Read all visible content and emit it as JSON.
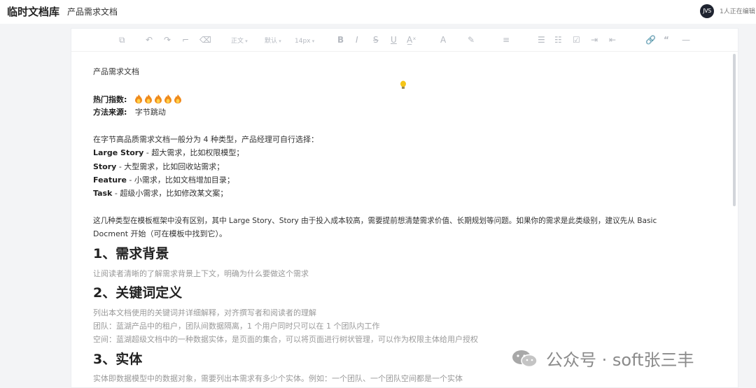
{
  "app": {
    "title": "临时文档库",
    "doc_title": "产品需求文档",
    "avatar_text": "JVS",
    "editing_status": "1人正在编辑"
  },
  "toolbar": {
    "paragraph": "正文",
    "font": "默认",
    "size": "14px"
  },
  "doc": {
    "title": "产品需求文档",
    "hot_label": "热门指数:",
    "hot_count": 5,
    "source_label": "方法来源:",
    "source_value": "字节跳动",
    "intro": "在字节高品质需求文档一般分为 4 种类型，产品经理可自行选择：",
    "types": [
      {
        "name": "Large Story",
        "desc": " - 超大需求，比如权限模型；"
      },
      {
        "name": "Story",
        "desc": " - 大型需求，比如回收站需求；"
      },
      {
        "name": "Feature",
        "desc": " - 小需求，比如文档增加目录；"
      },
      {
        "name": "Task",
        "desc": " - 超级小需求，比如修改某文案；"
      }
    ],
    "para_line1": "这几种类型在模板框架中没有区别，其中 Large Story、Story 由于投入成本较高，需要提前想清楚需求价值、长期规划等问题。如果你的需求是此类级别，建议先从 Basic",
    "para_line2": "Docment 开始（可在模板中找到它）。",
    "section1_title": "1、需求背景",
    "section1_desc": "让阅读者清晰的了解需求背景上下文，明确为什么要做这个需求",
    "section2_title": "2、关键词定义",
    "section2_lines": [
      "列出本文档使用的关键词并详细解释，对齐撰写者和阅读者的理解",
      "团队：蓝湖产品中的租户，团队间数据隔离，1 个用户同时只可以在 1 个团队内工作",
      "空间：蓝湖超级文档中的一种数据实体，是页面的集合，可以将页面进行树状管理，可以作为权限主体给用户授权"
    ],
    "section3_title": "3、实体",
    "section3_desc": "实体即数据模型中的数据对象，需要列出本需求有多少个实体。例如：一个团队、一个团队空间都是一个实体"
  },
  "watermark": {
    "text": "公众号 · soft张三丰"
  },
  "colors": {
    "flame_outer": "#f08a1c",
    "flame_inner": "#ffd24a",
    "bulb": "#f5c518"
  }
}
